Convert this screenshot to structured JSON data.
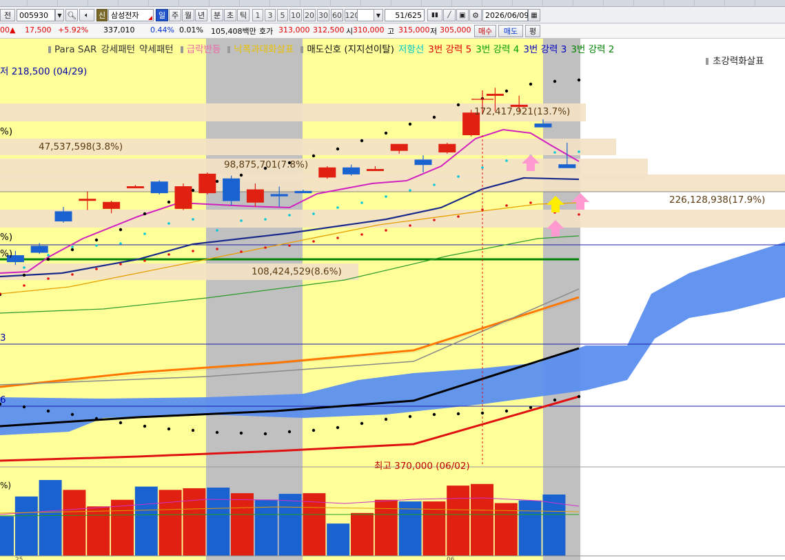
{
  "toolbar_top": {
    "labels": [
      "",
      "",
      "",
      "",
      "",
      "",
      "",
      "",
      "",
      "",
      "",
      "",
      "",
      "",
      "",
      "",
      "",
      "",
      "",
      "",
      "",
      "",
      "",
      "",
      "",
      ""
    ]
  },
  "toolbar": {
    "prefix_label": "전",
    "stock_code": "005930",
    "badge_label": "신",
    "stock_name": "삼성전자",
    "period_tabs": [
      "일",
      "주",
      "월",
      "년",
      "분",
      "초",
      "틱"
    ],
    "selected_tab": "일",
    "interval_buttons": [
      "1",
      "3",
      "5",
      "10",
      "20",
      "30",
      "60",
      "120"
    ],
    "page_position": "51",
    "page_total": "/625",
    "date_value": "2026/06/09"
  },
  "quote_bar": {
    "price_prefix": "00",
    "change_arrow": "▲",
    "change_value": "17,500",
    "change_pct": "+5.92%",
    "volume": "337,010",
    "turnover_pct": "0.44%",
    "ratio_pct": "0.01%",
    "amount": "105,408백만",
    "ask_label": "호가",
    "ask_price": "313,000",
    "bid_price": "312,500",
    "open_label": "시",
    "open_price": "310,000",
    "high_label": "고",
    "high_price": "315,000",
    "low_label": "저",
    "low_price": "305,000",
    "buy_button": "매수",
    "sell_button": "매도",
    "eval_button": "평"
  },
  "legend": {
    "items": [
      {
        "text": "Para SAR",
        "color": "#333333"
      },
      {
        "text": "강세패턴",
        "color": "#333333"
      },
      {
        "text": "약세패턴",
        "color": "#333333"
      },
      {
        "text": "급락반등",
        "color": "#ee66aa"
      },
      {
        "text": "낙폭과대화살표",
        "color": "#e8c000"
      },
      {
        "text": "매도신호 (지지선이탈)",
        "color": "#111111"
      },
      {
        "text": "저항선",
        "color": "#00c8c8"
      },
      {
        "text": "3번 강력 5",
        "color": "#e00000"
      },
      {
        "text": "3번 강력 4",
        "color": "#00a000"
      },
      {
        "text": "3번 강력 3",
        "color": "#0000c0"
      },
      {
        "text": "3번 강력 2",
        "color": "#008000"
      },
      {
        "text": "초강력화살표",
        "color": "#222222"
      }
    ]
  },
  "annotations": {
    "low_marker": "저 218,500 (04/29)",
    "max_marker": "최고 370,000 (06/02)",
    "vol_profile_1": "172,417,921(13.7%)",
    "vol_profile_2": "47,537,598(3.8%)",
    "vol_profile_3": "98,875,701(7.8%)",
    "vol_profile_4": "226,128,938(17.9%)",
    "vol_profile_5": "108,424,529(8.6%)",
    "left_edge_1": "%)",
    "left_edge_2": "%)",
    "left_edge_3": "%)",
    "left_edge_4": "3",
    "left_edge_5": "6",
    "left_edge_vol": "%)",
    "axis_date_1": "25",
    "axis_date_2": "06"
  },
  "chart_data": {
    "type": "candlestick",
    "candles": [
      {
        "o": 218,
        "h": 221,
        "l": 212,
        "c": 214
      },
      {
        "o": 224,
        "h": 226,
        "l": 219,
        "c": 220
      },
      {
        "o": 246,
        "h": 249,
        "l": 239,
        "c": 240
      },
      {
        "o": 254,
        "h": 259,
        "l": 247,
        "c": 254
      },
      {
        "o": 248,
        "h": 253,
        "l": 245,
        "c": 252
      },
      {
        "o": 262,
        "h": 263,
        "l": 261,
        "c": 262
      },
      {
        "o": 265,
        "h": 266,
        "l": 257,
        "c": 258
      },
      {
        "o": 248,
        "h": 264,
        "l": 247,
        "c": 262
      },
      {
        "o": 258,
        "h": 271,
        "l": 257,
        "c": 270
      },
      {
        "o": 267,
        "h": 269,
        "l": 250,
        "c": 253
      },
      {
        "o": 252,
        "h": 264,
        "l": 249,
        "c": 260
      },
      {
        "o": 257,
        "h": 262,
        "l": 249,
        "c": 256
      },
      {
        "o": 259,
        "h": 260,
        "l": 258,
        "c": 258
      },
      {
        "o": 268,
        "h": 275,
        "l": 267,
        "c": 274
      },
      {
        "o": 274,
        "h": 276,
        "l": 269,
        "c": 270
      },
      {
        "o": 273,
        "h": 275,
        "l": 272,
        "c": 273
      },
      {
        "o": 285,
        "h": 289,
        "l": 283,
        "c": 289
      },
      {
        "o": 279,
        "h": 282,
        "l": 271,
        "c": 276
      },
      {
        "o": 284,
        "h": 290,
        "l": 283,
        "c": 289
      },
      {
        "o": 295,
        "h": 311,
        "l": 294,
        "c": 309
      },
      {
        "o": 321,
        "h": 325,
        "l": 310,
        "c": 321
      },
      {
        "o": 313,
        "h": 320,
        "l": 310,
        "c": 314
      },
      {
        "o": 302,
        "h": 305,
        "l": 300,
        "c": 300
      },
      {
        "o": 276,
        "h": 290,
        "l": 274,
        "c": 274
      }
    ],
    "volume": [
      120,
      180,
      230,
      200,
      150,
      170,
      210,
      200,
      205,
      207,
      190,
      170,
      188,
      190,
      98,
      130,
      170,
      165,
      165,
      213,
      218,
      160,
      168,
      186
    ],
    "ylim": [
      200,
      330
    ]
  }
}
